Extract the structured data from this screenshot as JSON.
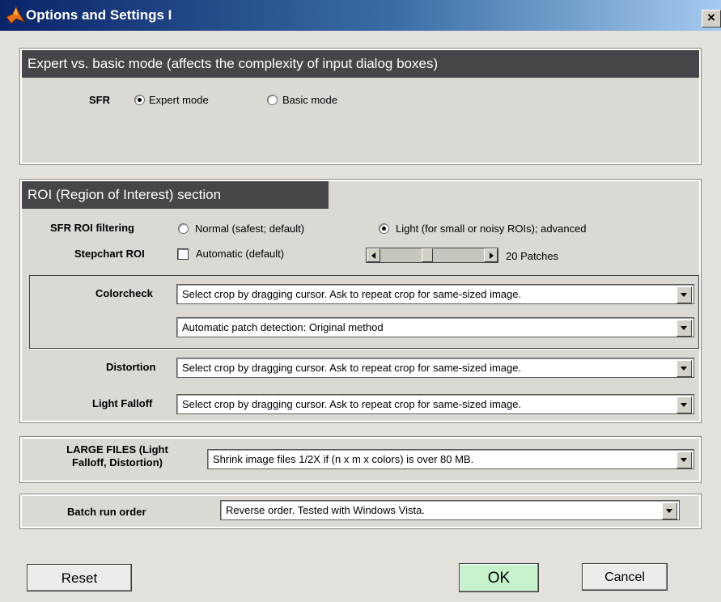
{
  "window": {
    "title": "Options and Settings I",
    "close_glyph": "×"
  },
  "expert_panel": {
    "header": "Expert vs. basic mode (affects the complexity of input dialog boxes)",
    "sfr_label": "SFR",
    "options": [
      "Expert mode",
      "Basic mode"
    ],
    "selected": "Expert mode"
  },
  "roi_panel": {
    "header": "ROI (Region of Interest) section",
    "sfr_roi_filtering": {
      "label": "SFR ROI filtering",
      "options": [
        "Normal (safest; default)",
        "Light (for small or noisy ROIs); advanced"
      ],
      "selected": "Light (for small or noisy ROIs); advanced"
    },
    "stepchart_roi": {
      "label": "Stepchart ROI",
      "checkbox_label": "Automatic (default)",
      "checked": false,
      "slider_position": 0.45,
      "patches_label": "20 Patches"
    },
    "colorcheck": {
      "label": "Colorcheck",
      "crop_value": "Select crop by dragging cursor. Ask to repeat crop for same-sized image.",
      "detection_value": "Automatic patch detection: Original method"
    },
    "distortion": {
      "label": "Distortion",
      "value": "Select crop by dragging cursor. Ask to repeat crop for same-sized image."
    },
    "light_falloff": {
      "label": "Light Falloff",
      "value": "Select crop by dragging cursor. Ask to repeat crop for same-sized image."
    }
  },
  "large_files": {
    "label_line1": "LARGE FILES (Light",
    "label_line2": "Falloff, Distortion)",
    "value": "Shrink image files 1/2X if  (n x m x colors)  is over 80 MB."
  },
  "batch": {
    "label": "Batch run order",
    "value": "Reverse order.    Tested with Windows Vista."
  },
  "buttons": {
    "reset": "Reset",
    "ok": "OK",
    "cancel": "Cancel"
  },
  "colors": {
    "title_bar_start": "#0a246a",
    "panel_header": "#46464a",
    "ok_button": "#c6f2cc"
  }
}
